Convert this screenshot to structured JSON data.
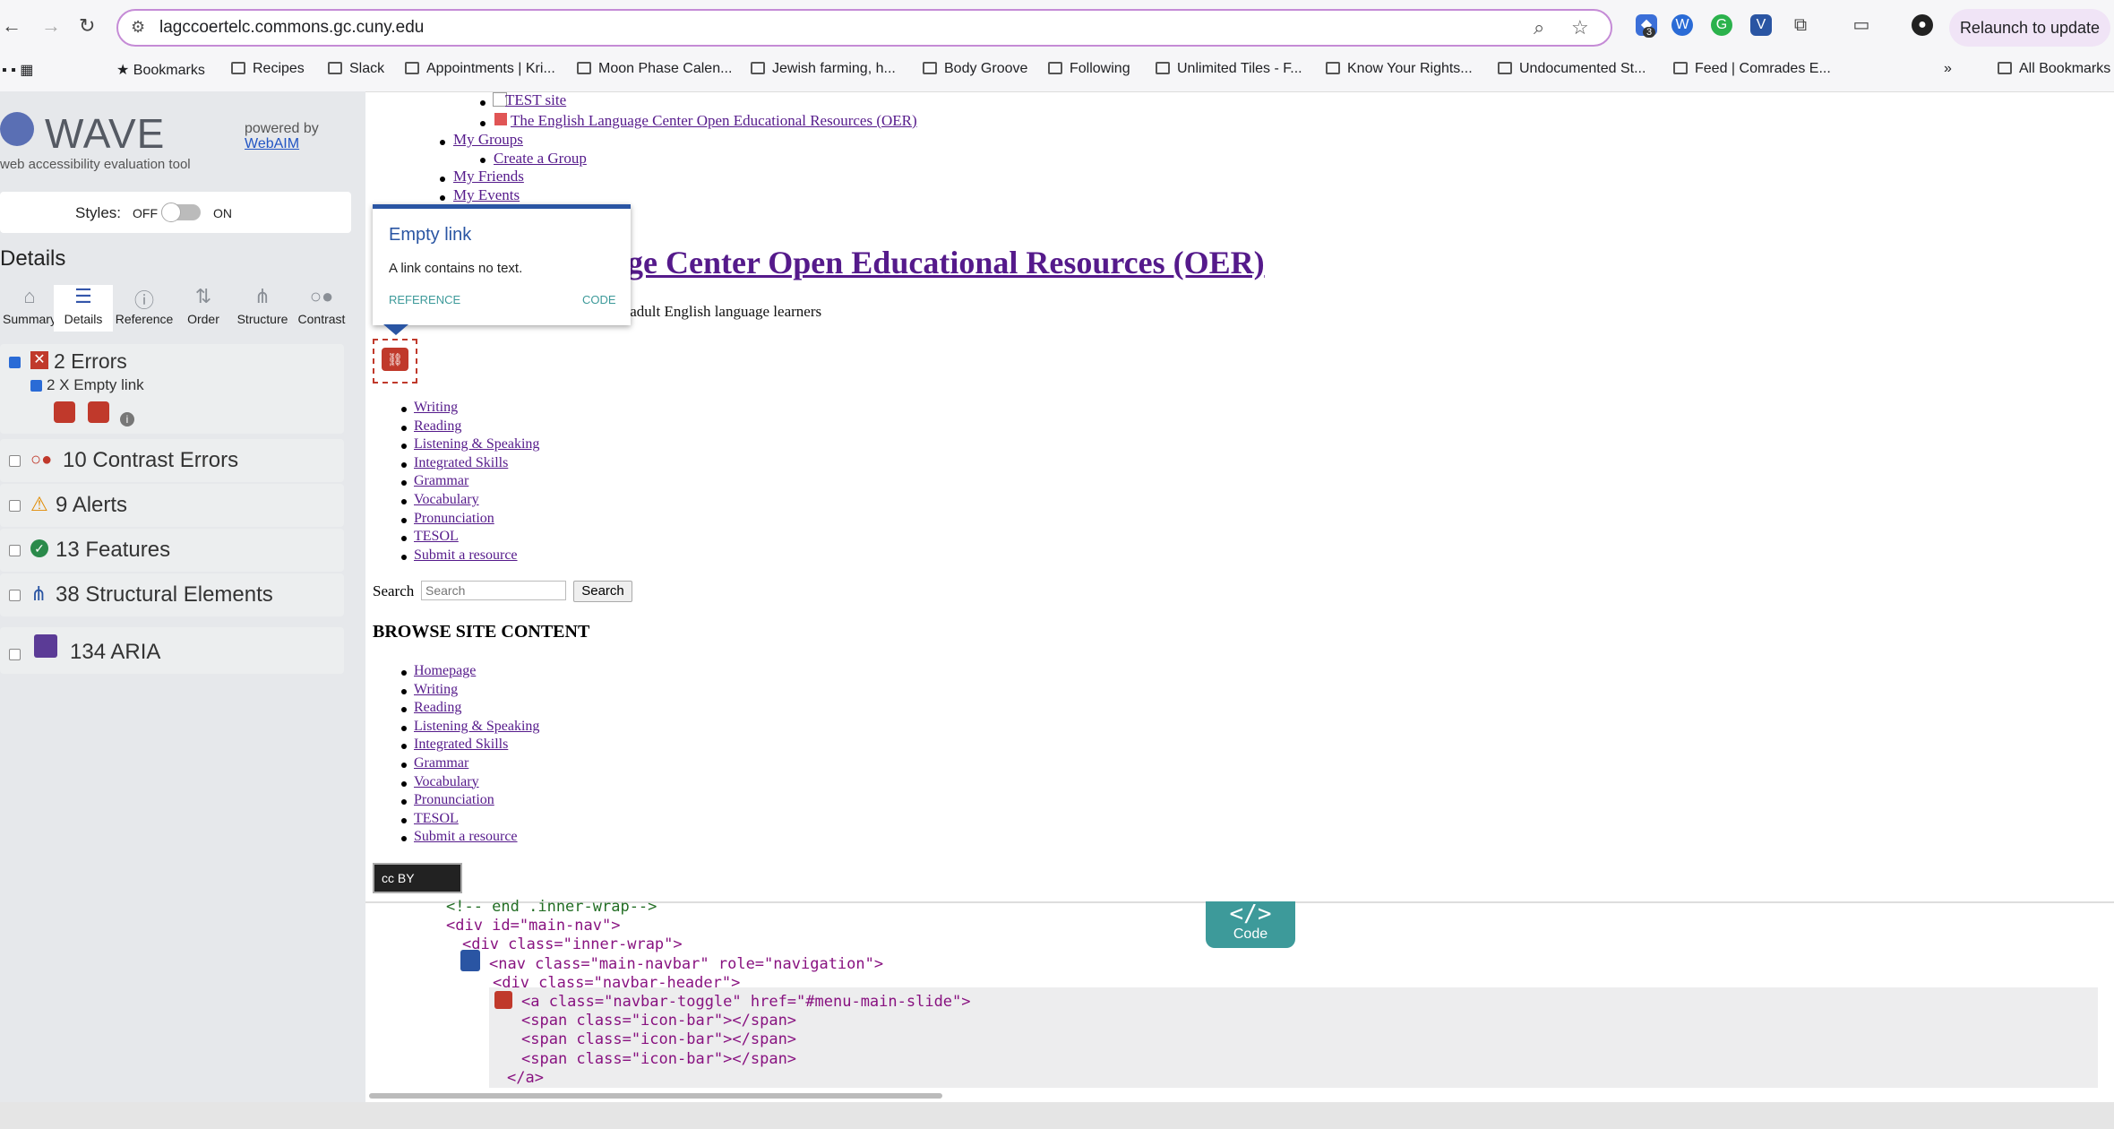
{
  "browser": {
    "url": "lagccoertelc.commons.gc.cuny.edu",
    "relaunch_label": "Relaunch to update",
    "extension_badge": "3",
    "bookmarks": [
      "Bookmarks",
      "Recipes",
      "Slack",
      "Appointments | Kri...",
      "Moon Phase Calen...",
      "Jewish farming, h...",
      "Body Groove",
      "Following",
      "Unlimited Tiles - F...",
      "Know Your Rights...",
      "Undocumented St...",
      "Feed | Comrades E..."
    ],
    "all_bookmarks": "All Bookmarks",
    "more_chevron": "»"
  },
  "wave": {
    "logo": "WAVE",
    "subtitle": "web accessibility evaluation tool",
    "powered_by": "powered by",
    "webaim": "WebAIM",
    "styles_label": "Styles:",
    "styles_off": "OFF",
    "styles_on": "ON",
    "details_heading": "Details",
    "tabs": [
      "Summary",
      "Details",
      "Reference",
      "Order",
      "Structure",
      "Contrast"
    ],
    "errors": {
      "label": "2 Errors",
      "sub": "2 X Empty link"
    },
    "categories": [
      "10 Contrast Errors",
      "9 Alerts",
      "13 Features",
      "38 Structural Elements",
      "134 ARIA"
    ]
  },
  "tooltip": {
    "title": "Empty link",
    "body": "A link contains no text.",
    "reference": "REFERENCE",
    "code": "CODE"
  },
  "page": {
    "top_links": {
      "test_site": "TEST site",
      "oer_link": "The English Language Center Open Educational Resources (OER)",
      "my_groups": "My Groups",
      "create_group": "Create a Group",
      "my_friends": "My Friends",
      "my_events": "My Events"
    },
    "title_fragment": "age Center Open Educational Resources (OER)",
    "tagline_fragment": "ng adult English language learners",
    "nav_primary": [
      "Writing",
      "Reading",
      "Listening & Speaking",
      "Integrated Skills",
      "Grammar",
      "Vocabulary",
      "Pronunciation",
      "TESOL",
      "Submit a resource"
    ],
    "search_label": "Search",
    "search_placeholder": "Search",
    "search_button": "Search",
    "browse_heading": "BROWSE SITE CONTENT",
    "nav_browse": [
      "Homepage",
      "Writing",
      "Reading",
      "Listening & Speaking",
      "Integrated Skills",
      "Grammar",
      "Vocabulary",
      "Pronunciation",
      "TESOL",
      "Submit a resource"
    ],
    "cc_badge": "cc BY"
  },
  "code_panel": {
    "button_label": "Code",
    "button_symbol": "</>",
    "lines": [
      {
        "t": "comment",
        "text": "<!-- end .inner-wrap-->"
      },
      {
        "t": "tag",
        "text": "<div id=\"main-nav\">"
      },
      {
        "t": "tag",
        "text": "<div class=\"inner-wrap\">"
      },
      {
        "t": "tag",
        "text": "<nav class=\"main-navbar\" role=\"navigation\">"
      },
      {
        "t": "tag",
        "text": "<div class=\"navbar-header\">"
      },
      {
        "t": "tag",
        "text": "<a class=\"navbar-toggle\" href=\"#menu-main-slide\">"
      },
      {
        "t": "tag",
        "text": "<span class=\"icon-bar\"></span>"
      },
      {
        "t": "tag",
        "text": "<span class=\"icon-bar\"></span>"
      },
      {
        "t": "tag",
        "text": "<span class=\"icon-bar\"></span>"
      },
      {
        "t": "tag",
        "text": "</a>"
      }
    ]
  }
}
